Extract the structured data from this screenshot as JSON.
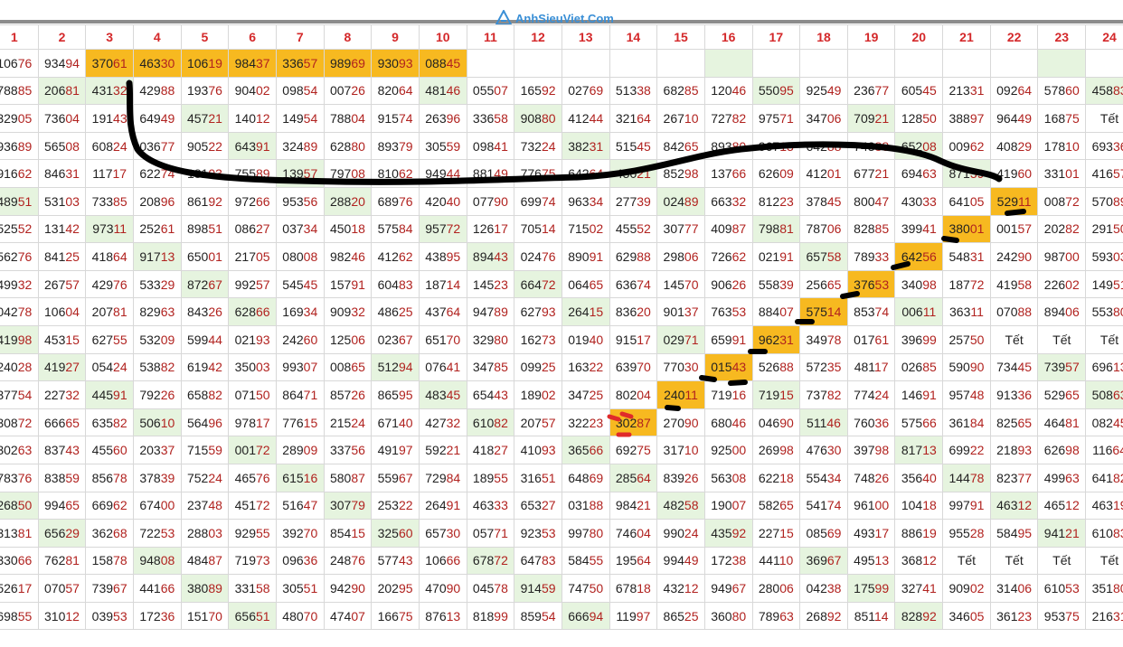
{
  "brand": {
    "logo_text": "AnhSieuViet.Com"
  },
  "columns": [
    "1",
    "2",
    "3",
    "4",
    "5",
    "6",
    "7",
    "8",
    "9",
    "10",
    "11",
    "12",
    "13",
    "14",
    "15",
    "16",
    "17",
    "18",
    "19",
    "20",
    "21",
    "22",
    "23",
    "24"
  ],
  "colors": {
    "green_cell": "#e6f4df",
    "orange_cell": "#f7b920",
    "header_text": "#d4282a",
    "last_digits": "#b1221f",
    "annotation": "#000000"
  },
  "rows": [
    [
      "10676",
      "93494",
      "37061",
      "46330",
      "10619",
      "98437",
      "33657",
      "98969",
      "93093",
      "08845",
      "",
      "",
      "",
      "",
      "",
      "",
      "",
      "",
      "",
      "",
      "",
      "",
      "",
      ""
    ],
    [
      "78885",
      "20681",
      "43132",
      "42988",
      "19376",
      "90402",
      "09854",
      "00726",
      "82064",
      "48146",
      "05507",
      "16592",
      "02769",
      "51338",
      "68285",
      "12046",
      "55095",
      "92549",
      "23677",
      "60545",
      "21331",
      "09264",
      "57860",
      "45883"
    ],
    [
      "32905",
      "73604",
      "19143",
      "64949",
      "45721",
      "14012",
      "14954",
      "78804",
      "91574",
      "26396",
      "33658",
      "90880",
      "41244",
      "32164",
      "26710",
      "72782",
      "97571",
      "34706",
      "70921",
      "12850",
      "38897",
      "96449",
      "16875",
      "Tết"
    ],
    [
      "93689",
      "56508",
      "60824",
      "03677",
      "90522",
      "64391",
      "32489",
      "62880",
      "89379",
      "30559",
      "09841",
      "73224",
      "38231",
      "51545",
      "84265",
      "89380",
      "96713",
      "64288",
      "74388",
      "65208",
      "00962",
      "40829",
      "17810",
      "69336"
    ],
    [
      "91662",
      "84631",
      "11717",
      "62274",
      "18103",
      "75589",
      "13957",
      "79708",
      "81062",
      "94944",
      "88149",
      "77675",
      "64264",
      "45021",
      "85298",
      "13766",
      "62609",
      "41201",
      "67721",
      "69463",
      "87139",
      "41960",
      "33101",
      "41657"
    ],
    [
      "48951",
      "53103",
      "73385",
      "20896",
      "86192",
      "97266",
      "95356",
      "28820",
      "68976",
      "42040",
      "07790",
      "69974",
      "96334",
      "27739",
      "02489",
      "66332",
      "81223",
      "37845",
      "80047",
      "43033",
      "64105",
      "52911",
      "00872",
      "57089"
    ],
    [
      "52552",
      "13142",
      "97311",
      "25261",
      "89851",
      "08627",
      "03734",
      "45018",
      "57584",
      "95772",
      "12617",
      "70514",
      "71502",
      "45552",
      "30777",
      "40987",
      "79881",
      "78706",
      "82885",
      "39941",
      "38001",
      "00157",
      "20282",
      "29150"
    ],
    [
      "56276",
      "84125",
      "41864",
      "91713",
      "65001",
      "21705",
      "08008",
      "98246",
      "41262",
      "43895",
      "89443",
      "02476",
      "89091",
      "62988",
      "29806",
      "72662",
      "02191",
      "65758",
      "78933",
      "64256",
      "54831",
      "24290",
      "98700",
      "59303"
    ],
    [
      "49932",
      "26757",
      "42976",
      "53329",
      "87267",
      "99257",
      "54545",
      "15791",
      "60483",
      "18714",
      "14523",
      "66472",
      "06465",
      "63674",
      "14570",
      "90626",
      "55839",
      "25665",
      "37653",
      "34098",
      "18772",
      "41958",
      "22602",
      "14951"
    ],
    [
      "04278",
      "10604",
      "20781",
      "82963",
      "84326",
      "62866",
      "16934",
      "90932",
      "48625",
      "43764",
      "94789",
      "62793",
      "26415",
      "83620",
      "90137",
      "76353",
      "88407",
      "57514",
      "85374",
      "00611",
      "36311",
      "07088",
      "89406",
      "55380"
    ],
    [
      "41998",
      "45315",
      "62755",
      "53209",
      "59944",
      "02193",
      "24260",
      "12506",
      "02367",
      "65170",
      "32980",
      "16273",
      "01940",
      "91517",
      "02971",
      "65991",
      "96231",
      "34978",
      "01761",
      "39699",
      "25750",
      "Tết",
      "Tết",
      "Tết"
    ],
    [
      "24028",
      "41927",
      "05424",
      "53882",
      "61942",
      "35003",
      "99307",
      "00865",
      "51294",
      "07641",
      "34785",
      "09925",
      "16322",
      "63970",
      "77030",
      "01543",
      "52688",
      "57235",
      "48117",
      "02685",
      "59090",
      "73445",
      "73957",
      "69613"
    ],
    [
      "37754",
      "22732",
      "44591",
      "79226",
      "65882",
      "07150",
      "86471",
      "85726",
      "86595",
      "48345",
      "65443",
      "18902",
      "34725",
      "80204",
      "24011",
      "71916",
      "71915",
      "73782",
      "77424",
      "14691",
      "95748",
      "91336",
      "52965",
      "50863"
    ],
    [
      "30872",
      "66665",
      "63582",
      "50610",
      "56496",
      "97817",
      "77615",
      "21524",
      "67140",
      "42732",
      "61082",
      "20757",
      "32223",
      "30287",
      "27090",
      "68046",
      "04690",
      "51146",
      "76036",
      "57566",
      "36184",
      "82565",
      "46481",
      "08245"
    ],
    [
      "30263",
      "83743",
      "45560",
      "20337",
      "71559",
      "00172",
      "28909",
      "33756",
      "49197",
      "59221",
      "41827",
      "41093",
      "36566",
      "69275",
      "31710",
      "92500",
      "26998",
      "47630",
      "39798",
      "81713",
      "69922",
      "21893",
      "62698",
      "11664"
    ],
    [
      "78376",
      "83859",
      "85678",
      "37839",
      "75224",
      "46576",
      "61516",
      "58087",
      "55967",
      "72984",
      "18955",
      "31651",
      "64869",
      "28564",
      "83926",
      "56308",
      "62218",
      "55434",
      "74826",
      "35640",
      "14478",
      "82377",
      "49963",
      "64182"
    ],
    [
      "26850",
      "99465",
      "66962",
      "67400",
      "23748",
      "45172",
      "51647",
      "30779",
      "25322",
      "26491",
      "46333",
      "65327",
      "03188",
      "98421",
      "48258",
      "19007",
      "58265",
      "54174",
      "96100",
      "10418",
      "99791",
      "46312",
      "46512",
      "46319"
    ],
    [
      "31381",
      "65629",
      "36268",
      "72253",
      "28803",
      "92955",
      "39270",
      "85415",
      "32560",
      "65730",
      "05771",
      "92353",
      "99780",
      "74604",
      "99024",
      "43592",
      "22715",
      "08569",
      "49317",
      "88619",
      "95528",
      "58495",
      "94121",
      "61083"
    ],
    [
      "33066",
      "76281",
      "15878",
      "94808",
      "48487",
      "71973",
      "09636",
      "24876",
      "57743",
      "10666",
      "67872",
      "64783",
      "58455",
      "19564",
      "99449",
      "17238",
      "44110",
      "36967",
      "49513",
      "36812",
      "Tết",
      "Tết",
      "Tết",
      "Tết"
    ],
    [
      "52617",
      "07057",
      "73967",
      "44166",
      "38089",
      "33158",
      "30551",
      "94290",
      "20295",
      "47090",
      "04578",
      "91459",
      "74750",
      "67818",
      "43212",
      "94967",
      "28006",
      "04238",
      "17599",
      "32741",
      "90902",
      "31406",
      "61053",
      "35180"
    ],
    [
      "69855",
      "31012",
      "03953",
      "17236",
      "15170",
      "65651",
      "48070",
      "47407",
      "16675",
      "87613",
      "81899",
      "85954",
      "66694",
      "11997",
      "86525",
      "36080",
      "78963",
      "26892",
      "85114",
      "82892",
      "34605",
      "36123",
      "95375",
      "21631"
    ]
  ],
  "highlights": {
    "orange": [
      [
        0,
        2
      ],
      [
        0,
        3
      ],
      [
        0,
        4
      ],
      [
        0,
        5
      ],
      [
        0,
        6
      ],
      [
        0,
        7
      ],
      [
        0,
        8
      ],
      [
        0,
        9
      ],
      [
        5,
        21
      ],
      [
        6,
        20
      ],
      [
        7,
        19
      ],
      [
        8,
        18
      ],
      [
        9,
        17
      ],
      [
        10,
        16
      ],
      [
        11,
        15
      ],
      [
        12,
        14
      ],
      [
        13,
        13
      ]
    ],
    "green": [
      [
        0,
        15
      ],
      [
        0,
        22
      ],
      [
        1,
        1
      ],
      [
        1,
        2
      ],
      [
        1,
        9
      ],
      [
        1,
        16
      ],
      [
        1,
        23
      ],
      [
        2,
        4
      ],
      [
        2,
        11
      ],
      [
        2,
        18
      ],
      [
        3,
        5
      ],
      [
        3,
        12
      ],
      [
        3,
        19
      ],
      [
        4,
        6
      ],
      [
        4,
        13
      ],
      [
        4,
        20
      ],
      [
        5,
        0
      ],
      [
        5,
        7
      ],
      [
        5,
        14
      ],
      [
        6,
        2
      ],
      [
        6,
        9
      ],
      [
        6,
        16
      ],
      [
        7,
        3
      ],
      [
        7,
        10
      ],
      [
        7,
        17
      ],
      [
        8,
        4
      ],
      [
        8,
        11
      ],
      [
        9,
        5
      ],
      [
        9,
        12
      ],
      [
        9,
        19
      ],
      [
        10,
        0
      ],
      [
        10,
        14
      ],
      [
        11,
        1
      ],
      [
        11,
        8
      ],
      [
        11,
        22
      ],
      [
        12,
        2
      ],
      [
        12,
        9
      ],
      [
        12,
        16
      ],
      [
        12,
        23
      ],
      [
        13,
        3
      ],
      [
        13,
        10
      ],
      [
        13,
        17
      ],
      [
        14,
        5
      ],
      [
        14,
        12
      ],
      [
        14,
        19
      ],
      [
        15,
        6
      ],
      [
        15,
        13
      ],
      [
        15,
        20
      ],
      [
        16,
        0
      ],
      [
        16,
        7
      ],
      [
        16,
        14
      ],
      [
        16,
        21
      ],
      [
        17,
        1
      ],
      [
        17,
        8
      ],
      [
        17,
        15
      ],
      [
        17,
        22
      ],
      [
        18,
        3
      ],
      [
        18,
        10
      ],
      [
        18,
        17
      ],
      [
        19,
        4
      ],
      [
        19,
        11
      ],
      [
        19,
        18
      ],
      [
        20,
        5
      ],
      [
        20,
        12
      ],
      [
        20,
        19
      ]
    ]
  }
}
